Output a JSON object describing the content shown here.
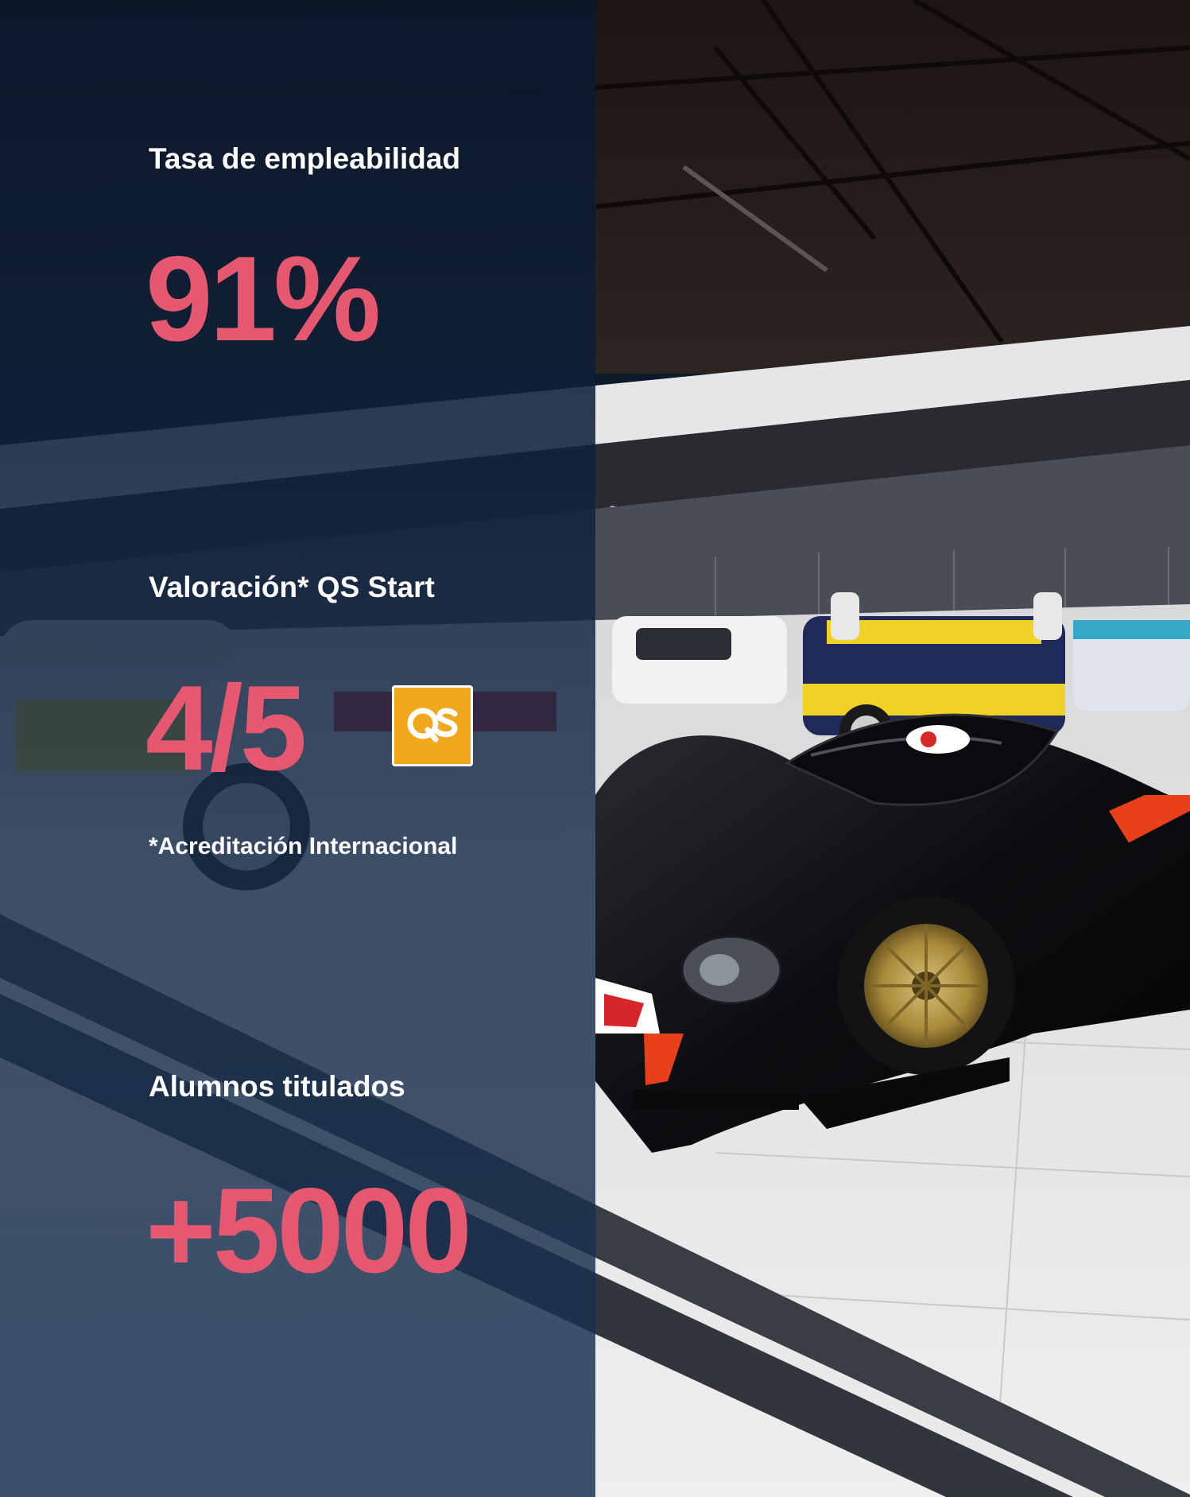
{
  "colors": {
    "accent": "#e5586f",
    "overlay": "#0e2038",
    "text": "#ffffff",
    "qs_badge": "#f2a81d"
  },
  "stats": [
    {
      "label": "Tasa de empleabilidad",
      "value": "91%"
    },
    {
      "label": "Valoración* QS Start",
      "value": "4/5",
      "note": "*Acreditación Internacional",
      "badge_icon": "qs-logo-icon"
    },
    {
      "label": "Alumnos titulados",
      "value": "+5000"
    }
  ],
  "background": {
    "icon": "race-car-museum-photo"
  }
}
